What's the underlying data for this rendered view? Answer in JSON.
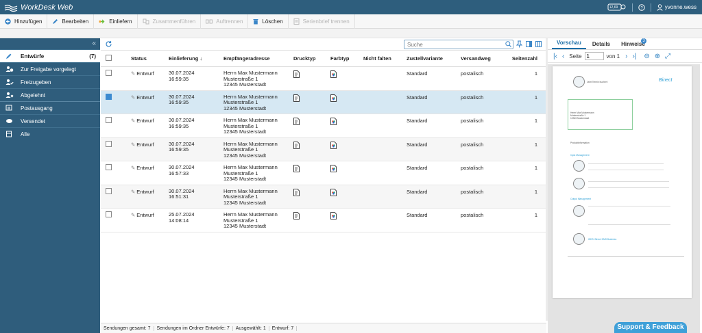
{
  "app": {
    "title": "WorkDesk Web",
    "user": "yvonne.wess",
    "counter_badge": "12,69"
  },
  "toolbar": [
    {
      "label": "Hinzufügen",
      "icon": "plus-circle-icon",
      "enabled": true
    },
    {
      "label": "Bearbeiten",
      "icon": "pencil-icon",
      "enabled": true
    },
    {
      "label": "Einliefern",
      "icon": "deliver-icon",
      "enabled": true
    },
    {
      "label": "Zusammenführen",
      "icon": "merge-icon",
      "enabled": false
    },
    {
      "label": "Auftrennen",
      "icon": "split-icon",
      "enabled": false
    },
    {
      "label": "Löschen",
      "icon": "trash-icon",
      "enabled": true
    },
    {
      "label": "Serienbrief trennen",
      "icon": "serial-letter-icon",
      "enabled": false
    }
  ],
  "sidebar": {
    "items": [
      {
        "label": "Entwürfe",
        "count": "(7)",
        "icon": "edit-draft-icon",
        "active": true
      },
      {
        "label": "Zur Freigabe vorgelegt",
        "icon": "users-pending-icon"
      },
      {
        "label": "Freizugeben",
        "icon": "users-approve-icon"
      },
      {
        "label": "Abgelehnt",
        "icon": "users-reject-icon"
      },
      {
        "label": "Postausgang",
        "icon": "outbox-icon"
      },
      {
        "label": "Versendet",
        "icon": "sent-icon"
      },
      {
        "label": "Alle",
        "icon": "archive-icon"
      }
    ]
  },
  "search": {
    "placeholder": "Suche"
  },
  "table": {
    "columns": [
      "Status",
      "Einlieferung ↓",
      "Empfängeradresse",
      "Drucktyp",
      "Farbtyp",
      "Nicht falten",
      "Zustellvariante",
      "Versandweg",
      "Seitenzahl"
    ],
    "rows": [
      {
        "status": "Entwurf",
        "date": "30.07.2024",
        "time": "16:59:35",
        "addr1": "Herrn Max Mustermann",
        "addr2": "Musterstraße 1",
        "addr3": "12345 Musterstadt",
        "zustell": "Standard",
        "versand": "postalisch",
        "seiten": "1",
        "selected": false
      },
      {
        "status": "Entwurf",
        "date": "30.07.2024",
        "time": "16:59:35",
        "addr1": "Herrn Max Mustermann",
        "addr2": "Musterstraße 1",
        "addr3": "12345 Musterstadt",
        "zustell": "Standard",
        "versand": "postalisch",
        "seiten": "1",
        "selected": true
      },
      {
        "status": "Entwurf",
        "date": "30.07.2024",
        "time": "16:59:35",
        "addr1": "Herrn Max Mustermann",
        "addr2": "Musterstraße 1",
        "addr3": "12345 Musterstadt",
        "zustell": "Standard",
        "versand": "postalisch",
        "seiten": "1",
        "selected": false
      },
      {
        "status": "Entwurf",
        "date": "30.07.2024",
        "time": "16:59:35",
        "addr1": "Herrn Max Mustermann",
        "addr2": "Musterstraße 1",
        "addr3": "12345 Musterstadt",
        "zustell": "Standard",
        "versand": "postalisch",
        "seiten": "1",
        "selected": false
      },
      {
        "status": "Entwurf",
        "date": "30.07.2024",
        "time": "16:57:33",
        "addr1": "Herrn Max Mustermann",
        "addr2": "Musterstraße 1",
        "addr3": "12345 Musterstadt",
        "zustell": "Standard",
        "versand": "postalisch",
        "seiten": "1",
        "selected": false
      },
      {
        "status": "Entwurf",
        "date": "30.07.2024",
        "time": "16:51:31",
        "addr1": "Herrn Max Mustermann",
        "addr2": "Musterstraße 1",
        "addr3": "12345 Musterstadt",
        "zustell": "Standard",
        "versand": "postalisch",
        "seiten": "1",
        "selected": false
      },
      {
        "status": "Entwurf",
        "date": "25.07.2024",
        "time": "14:08:14",
        "addr1": "Herrn Max Mustermann",
        "addr2": "Musterstraße 1",
        "addr3": "12345 Musterstadt",
        "zustell": "Standard",
        "versand": "postalisch",
        "seiten": "1",
        "selected": false
      }
    ]
  },
  "footer": {
    "gesamt": "Sendungen gesamt: 7",
    "ordner": "Sendungen im Ordner Entwürfe: 7",
    "ausgewaehlt": "Ausgewählt: 1",
    "entwurf": "Entwurf: 7"
  },
  "preview": {
    "tabs": [
      "Vorschau",
      "Details",
      "Hinweise"
    ],
    "hinweise_badge": "3",
    "page_label": "Seite",
    "page_value": "1",
    "of_label": "von 1",
    "doc": {
      "header_left": "Jetzt Termin buchen!",
      "brand": "Binect",
      "recipient": [
        "Herrn Max Mustermann",
        "Musterstraße 1",
        "12345 Musterstadt"
      ],
      "subject": "Produktinformation",
      "section1": "Input Management",
      "section2": "Output Management",
      "section3": "WDS: Binect DMS Business"
    }
  },
  "support": {
    "label": "Support & Feedback"
  },
  "colors": {
    "topbar": "#2e5e7d",
    "sidebar": "#2f5d7c",
    "accent": "#1d6fa7",
    "selected_row": "#d6e8f3",
    "support": "#3fa0d8"
  }
}
